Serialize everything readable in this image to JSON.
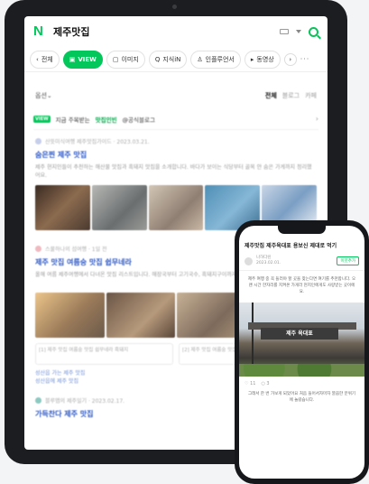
{
  "header": {
    "query": "제주맛집"
  },
  "tabs": [
    {
      "label": "전체",
      "icon": "chevron-left-icon"
    },
    {
      "label": "VIEW",
      "icon": "view-icon",
      "active": true
    },
    {
      "label": "이미지",
      "icon": "image-icon"
    },
    {
      "label": "지식iN",
      "icon": "q-icon"
    },
    {
      "label": "인플루언서",
      "icon": "person-icon"
    },
    {
      "label": "동영상",
      "icon": "play-icon"
    }
  ],
  "sort": {
    "option": "옵션",
    "all": "전체",
    "blog": "블로그",
    "cafe": "카페"
  },
  "recommend": {
    "badge": "VIEW",
    "prefix": "지금 주목받는",
    "highlight": "맛집인빈",
    "suffix": "@공식블로그"
  },
  "posts": [
    {
      "author": "산뜻미식여행 제주맛집가이드 · 2023.03.21.",
      "title": "숨은찐 제주 맛집",
      "text": "제주 현지인들이 추천하는 해산물 맛집과 흑돼지 맛집을 소개합니다. 바다가 보이는 식당부터 골목 안 숨은 가게까지 정리했어요."
    },
    {
      "author": "스물하나의 섬여행 · 1일 전",
      "title": "제주 맛집 여름숭 맛집 쉽무네라",
      "text": "올해 여름 제주여행에서 다녀온 맛집 리스트입니다. 해장국부터 고기국수, 흑돼지구이까지 직접 먹어보고 솔직하게 적었어요."
    }
  ],
  "refs": [
    "[1] 제주 맛집 여름숭 맛집 쉽무네라 흑돼지",
    "[2] 제주 맛집 여름숭 맛집 쉽무네라 해물"
  ],
  "mini_links": [
    "성산읍 가는 제주 맛집",
    "성산읍에 제주 맛집"
  ],
  "post3": {
    "author": "블루맵의 제주일기 · 2023.02.17.",
    "title": "가득찬다 제주 맛집"
  },
  "phone": {
    "title": "제주맛집 제주육대표 용보신 제대로 먹기",
    "author": "나하다린",
    "date": "2023.02.01.",
    "follow": "이웃추가",
    "text1": "제주 여행 중 꼭 들러야 할 곳을 찾는다면 여기를 추천합니다. 오랜 시간 한자리를 지켜온 가게라 현지인에게도 사랑받는 곳이에요.",
    "sign": "제주 육대표",
    "likes": "♡ 11",
    "comments": "○ 3",
    "text2": "그래서 한 번 가보게 되었어요 처음 들어서자마자 깔끔한 분위기에 놀랐습니다."
  }
}
